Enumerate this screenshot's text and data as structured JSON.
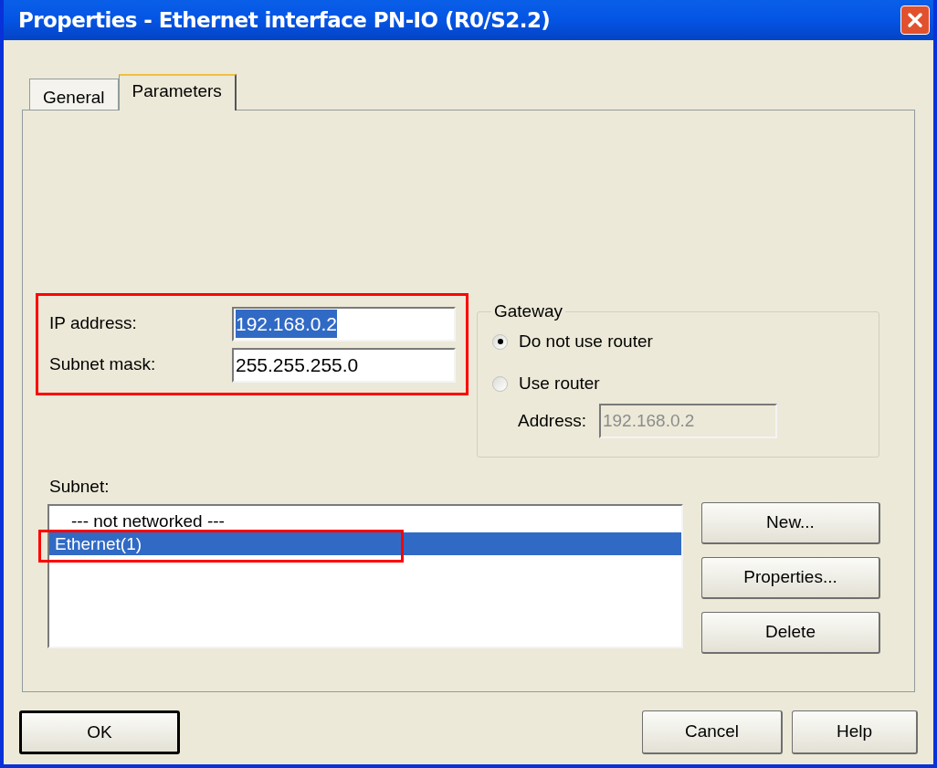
{
  "window": {
    "title": "Properties - Ethernet interface  PN-IO (R0/S2.2)"
  },
  "tabs": [
    {
      "label": "General",
      "selected": false
    },
    {
      "label": "Parameters",
      "selected": true
    }
  ],
  "ip_settings": {
    "annotated": true,
    "fields": [
      {
        "label": "IP address:",
        "value": "192.168.0.2",
        "text_selected": true
      },
      {
        "label": "Subnet mask:",
        "value": "255.255.255.0",
        "text_selected": false
      }
    ]
  },
  "gateway": {
    "title": "Gateway",
    "options": [
      {
        "label": "Do not use router",
        "selected": true
      },
      {
        "label": "Use router",
        "selected": false
      }
    ],
    "address": {
      "label": "Address:",
      "value": "192.168.0.2",
      "disabled": true
    }
  },
  "subnet": {
    "label": "Subnet:",
    "items": [
      {
        "label": "--- not networked ---",
        "selected": false,
        "annotated": false
      },
      {
        "label": "Ethernet(1)",
        "selected": true,
        "annotated": true
      }
    ],
    "buttons": [
      "New...",
      "Properties...",
      "Delete"
    ]
  },
  "footer_buttons": [
    {
      "label": "OK",
      "default": true
    },
    {
      "label": "Cancel",
      "default": false
    },
    {
      "label": "Help",
      "default": false
    }
  ]
}
